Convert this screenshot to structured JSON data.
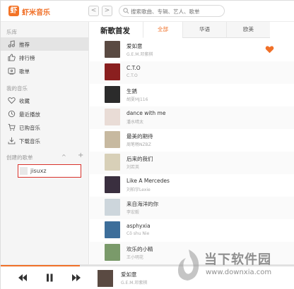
{
  "app": {
    "logo_char": "虾",
    "name": "虾米音乐"
  },
  "nav": {
    "back": "<",
    "forward": ">"
  },
  "search": {
    "placeholder": "搜索歌曲、专辑、艺人、歌单"
  },
  "sidebar": {
    "library_label": "乐库",
    "library_items": [
      {
        "label": "推荐",
        "icon": "music-note-icon",
        "active": true
      },
      {
        "label": "排行榜",
        "icon": "thumbs-up-icon",
        "active": false
      },
      {
        "label": "歌单",
        "icon": "playlist-icon",
        "active": false
      }
    ],
    "my_music_label": "我的音乐",
    "my_music_items": [
      {
        "label": "收藏",
        "icon": "heart-icon"
      },
      {
        "label": "最近播放",
        "icon": "clock-icon"
      },
      {
        "label": "已购音乐",
        "icon": "cart-icon"
      },
      {
        "label": "下载音乐",
        "icon": "download-icon"
      }
    ],
    "created_label": "创建的歌单",
    "collapse_glyph": "^",
    "add_glyph": "+",
    "playlists": [
      {
        "name": "jisuxz"
      }
    ]
  },
  "main": {
    "title": "新歌首发",
    "tabs": [
      {
        "label": "全部",
        "active": true
      },
      {
        "label": "华语",
        "active": false
      },
      {
        "label": "欧美",
        "active": false
      }
    ],
    "songs": [
      {
        "title": "爱如意",
        "artist": "G.E.M.邓紫棋",
        "cover_color": "#5a4a42",
        "liked": true
      },
      {
        "title": "C.T.O",
        "artist": "C.T.O",
        "cover_color": "#8a1f1f",
        "liked": false
      },
      {
        "title": "生銹",
        "artist": "胡夏MJ116",
        "cover_color": "#2b2b2b",
        "liked": false
      },
      {
        "title": "dance with me",
        "artist": "潘水晴太",
        "cover_color": "#e9dcd6",
        "liked": false
      },
      {
        "title": "最美的期待",
        "artist": "周笔畅NZBZ",
        "cover_color": "#c7b9a0",
        "liked": false
      },
      {
        "title": "后来的我们",
        "artist": "刘若英",
        "cover_color": "#d8d0b8",
        "liked": false
      },
      {
        "title": "Like A Mercedes",
        "artist": "刘柏宇Lexie",
        "cover_color": "#3a2f3f",
        "liked": false
      },
      {
        "title": "来自海洋的你",
        "artist": "李宏毅",
        "cover_color": "#cdd6dc",
        "liked": false
      },
      {
        "title": "asphyxia",
        "artist": "Cö shu Nie",
        "cover_color": "#3d6e9a",
        "liked": false
      },
      {
        "title": "欢乐的小精",
        "artist": "王小明花",
        "cover_color": "#7a9a6a",
        "liked": false
      }
    ]
  },
  "player": {
    "prev": "prev-icon",
    "play": "pause-icon",
    "next": "next-icon",
    "progress": 0.27,
    "now_playing": {
      "title": "爱如意",
      "artist": "G.E.M.邓紫棋",
      "cover_color": "#5a4a42"
    }
  },
  "watermark": {
    "name": "当下软件园",
    "url": "www.downxia.com"
  },
  "colors": {
    "accent": "#f07028",
    "highlight_border": "#d8312b"
  }
}
